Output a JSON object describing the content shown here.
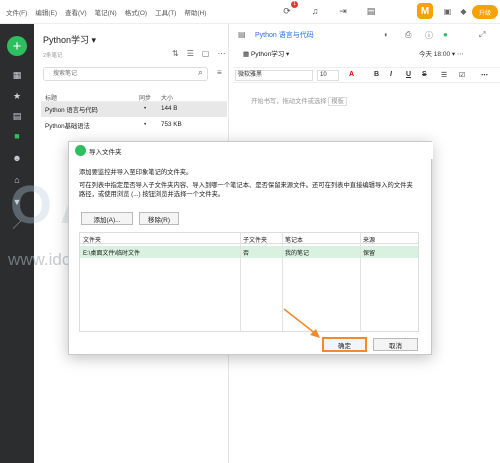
{
  "menu": [
    "文件(F)",
    "编辑(E)",
    "查看(V)",
    "笔记(N)",
    "格式(O)",
    "工具(T)",
    "帮助(H)"
  ],
  "toolbar_badge": "1",
  "avatar_letter": "M",
  "upgrade_label": "升级",
  "notebook": {
    "title": "Python学习",
    "count": "2条笔记",
    "search_placeholder": "搜索笔记",
    "columns": [
      "标题",
      "同步",
      "大小"
    ],
    "rows": [
      {
        "title": "Python 语言与代码",
        "sync": "•",
        "size": "144 B"
      },
      {
        "title": "Python基础语法",
        "sync": "•",
        "size": "753 KB"
      }
    ]
  },
  "editor": {
    "note_title": "Python 语言与代码",
    "notebook_select": "Python学习",
    "reminder": "今天 18:00",
    "font": "微软雅黑",
    "font_size": "10",
    "fmt": [
      "A",
      "B",
      "I",
      "U",
      "S"
    ],
    "hint": "开始书写，拖动文件或选择",
    "template_label": "模板"
  },
  "watermark": {
    "big": "OALK云试",
    "url": "www.idctalk.com-国内专业云计算交流服务平台"
  },
  "dialog": {
    "title": "导入文件夹",
    "desc1": "添加要监控并导入至印象笔记的文件夹。",
    "desc2": "可在列表中指定是否导入子文件夹内容、导入到哪一个笔记本、是否保留来源文件。还可在列表中直接编辑导入的文件夹路径，或使用浏览 (...) 按钮浏览并选择一个文件夹。",
    "add_label": "添加(A)...",
    "remove_label": "移除(R)",
    "columns": [
      "文件夹",
      "子文件夹",
      "笔记本",
      "来源"
    ],
    "row": {
      "folder": "E:\\桌面文件\\临时文件",
      "subfolder": "否",
      "notebook": "我的笔记",
      "source": "保留"
    },
    "ok_label": "确定",
    "cancel_label": "取消"
  },
  "colors": {
    "accent_green": "#2dbe60",
    "highlight_orange": "#f08a2c",
    "rail_bg": "#2b2d2f"
  }
}
